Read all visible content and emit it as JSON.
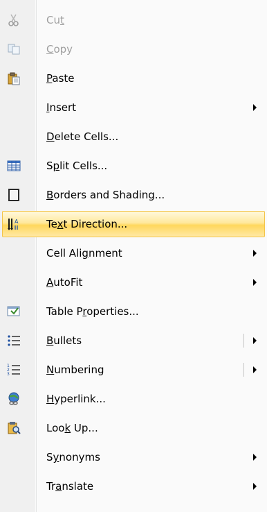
{
  "menu": {
    "items": [
      {
        "label": "Cut",
        "mn": "t",
        "icon": "scissors-icon",
        "disabled": true,
        "submenu": false,
        "split": false
      },
      {
        "label": "Copy",
        "mn": "C",
        "icon": "copy-icon",
        "disabled": true,
        "submenu": false,
        "split": false
      },
      {
        "label": "Paste",
        "mn": "P",
        "icon": "paste-icon",
        "disabled": false,
        "submenu": false,
        "split": false
      },
      {
        "label": "Insert",
        "mn": "I",
        "icon": null,
        "disabled": false,
        "submenu": true,
        "split": false
      },
      {
        "label": "Delete Cells...",
        "mn": "D",
        "icon": null,
        "disabled": false,
        "submenu": false,
        "split": false
      },
      {
        "label": "Split Cells...",
        "mn": "p",
        "icon": "table-grid-icon",
        "disabled": false,
        "submenu": false,
        "split": false
      },
      {
        "label": "Borders and Shading...",
        "mn": "B",
        "icon": "border-box-icon",
        "disabled": false,
        "submenu": false,
        "split": false
      },
      {
        "label": "Text Direction...",
        "mn": "x",
        "icon": "text-direction-icon",
        "disabled": false,
        "submenu": false,
        "split": false,
        "highlight": true
      },
      {
        "label": "Cell Alignment",
        "mn": "g",
        "icon": null,
        "disabled": false,
        "submenu": true,
        "split": false
      },
      {
        "label": "AutoFit",
        "mn": "A",
        "icon": null,
        "disabled": false,
        "submenu": true,
        "split": false
      },
      {
        "label": "Table Properties...",
        "mn": "r",
        "icon": "table-properties-icon",
        "disabled": false,
        "submenu": false,
        "split": false
      },
      {
        "label": "Bullets",
        "mn": "B",
        "icon": "bullets-icon",
        "disabled": false,
        "submenu": true,
        "split": true
      },
      {
        "label": "Numbering",
        "mn": "N",
        "icon": "numbering-icon",
        "disabled": false,
        "submenu": true,
        "split": true
      },
      {
        "label": "Hyperlink...",
        "mn": "H",
        "icon": "hyperlink-globe-icon",
        "disabled": false,
        "submenu": false,
        "split": false
      },
      {
        "label": "Look Up...",
        "mn": "k",
        "icon": "research-icon",
        "disabled": false,
        "submenu": false,
        "split": false
      },
      {
        "label": "Synonyms",
        "mn": "y",
        "icon": null,
        "disabled": false,
        "submenu": true,
        "split": false
      },
      {
        "label": "Translate",
        "mn": "a",
        "icon": null,
        "disabled": false,
        "submenu": true,
        "split": false
      }
    ],
    "separators_after": [
      2,
      4,
      6,
      10,
      12,
      13
    ],
    "highlight_color": "#ffd75c"
  }
}
